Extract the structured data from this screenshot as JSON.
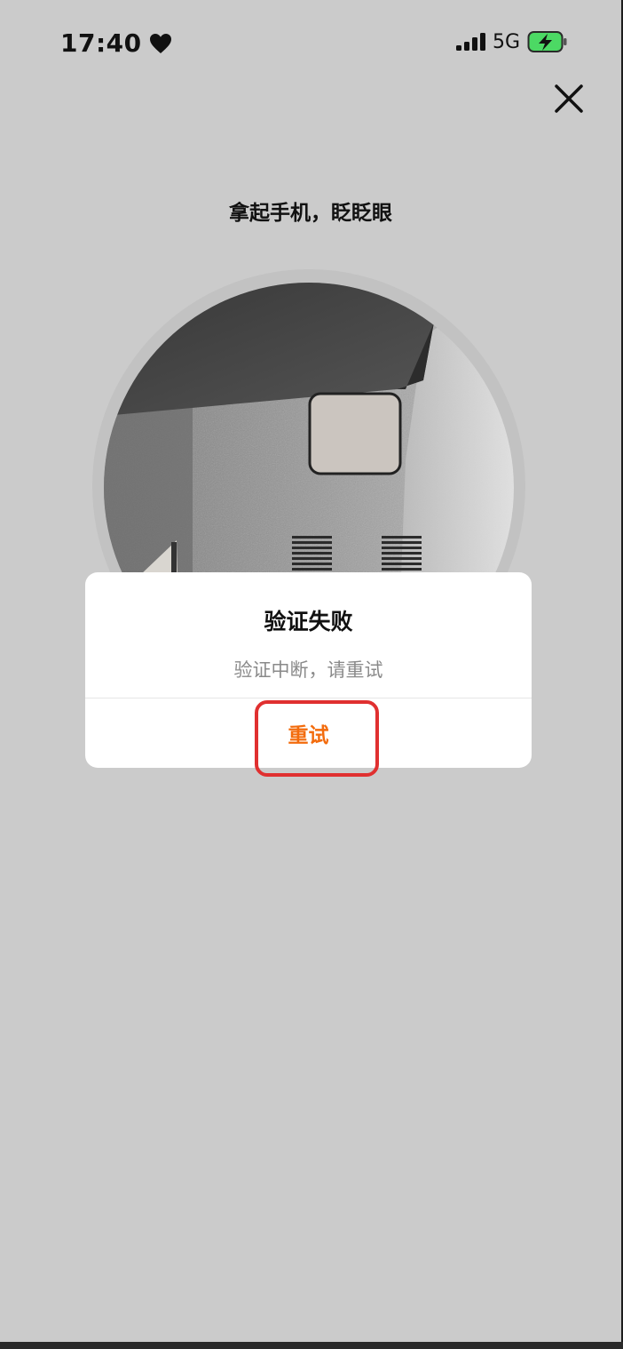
{
  "status_bar": {
    "time": "17:40",
    "network": "5G",
    "heart_icon": "heart-icon",
    "signal_icon": "signal-bars-icon",
    "battery_icon": "battery-charging-icon"
  },
  "header": {
    "close_icon": "close-icon"
  },
  "instruction": "拿起手机，眨眨眼",
  "dialog": {
    "title": "验证失败",
    "message": "验证中断，请重试",
    "retry_label": "重试"
  },
  "colors": {
    "accent": "#f36b0c",
    "highlight": "#e03030",
    "battery_fill": "#4cd964",
    "background": "#cbcbcb"
  }
}
